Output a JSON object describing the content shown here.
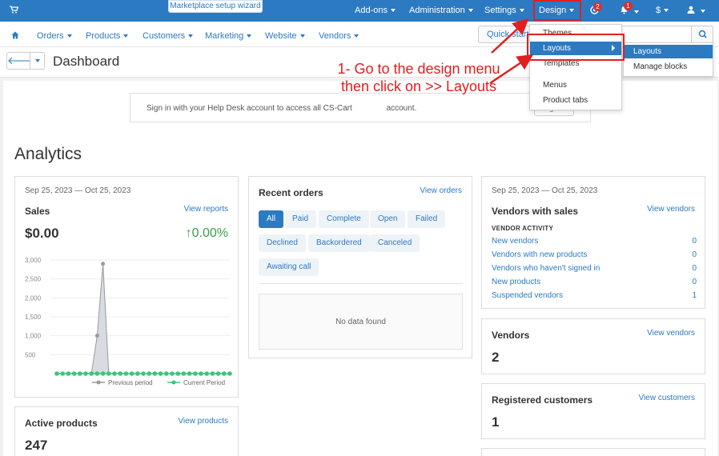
{
  "topbar": {
    "setup_button": "Marketplace setup wizard",
    "items": [
      "Add-ons",
      "Administration",
      "Settings",
      "Design"
    ],
    "cart_badge": "2",
    "bell_badge": "1",
    "currency": "$"
  },
  "subnav": {
    "items": [
      "Orders",
      "Products",
      "Customers",
      "Marketing",
      "Website",
      "Vendors"
    ],
    "quick_start": "Quick start"
  },
  "header": {
    "title": "Dashboard"
  },
  "design_menu": {
    "items": [
      "Themes",
      "Layouts",
      "Templates",
      "Menus",
      "Product tabs"
    ],
    "submenu": [
      "Layouts",
      "Manage blocks"
    ]
  },
  "annotation": "1- Go to the design menu then click on >> Layouts",
  "helpdesk": {
    "text": "Sign in with your Help Desk account to access all CS-Cart",
    "text_tail": "account.",
    "button": "Sign in"
  },
  "analytics_title": "Analytics",
  "sales": {
    "date_range": "Sep 25, 2023 — Oct 25, 2023",
    "title": "Sales",
    "link": "View reports",
    "amount": "$0.00",
    "change": "0.00%",
    "change_arrow": "↑",
    "legend_previous": "Previous period",
    "legend_current": "Current Period"
  },
  "recent_orders": {
    "title": "Recent orders",
    "link": "View orders",
    "filters": [
      "All",
      "Paid",
      "Complete",
      "Open",
      "Failed",
      "Declined",
      "Backordered",
      "Canceled",
      "Awaiting call"
    ],
    "empty": "No data found"
  },
  "vendors_sales": {
    "date_range": "Sep 25, 2023 — Oct 25, 2023",
    "title": "Vendors with sales",
    "link": "View vendors",
    "section_label": "VENDOR ACTIVITY",
    "rows": [
      {
        "label": "New vendors",
        "count": "0"
      },
      {
        "label": "Vendors with new products",
        "count": "0"
      },
      {
        "label": "Vendors who haven't signed in",
        "count": "0"
      },
      {
        "label": "New products",
        "count": "0"
      },
      {
        "label": "Suspended vendors",
        "count": "1"
      }
    ]
  },
  "vendors": {
    "title": "Vendors",
    "link": "View vendors",
    "value": "2"
  },
  "registered_customers": {
    "title": "Registered customers",
    "link": "View customers",
    "value": "1"
  },
  "active_products": {
    "title": "Active products",
    "link": "View products",
    "value": "247"
  },
  "chart_data": {
    "type": "area",
    "yticks": [
      "3,000",
      "2,500",
      "2,000",
      "1,500",
      "1,000",
      "500"
    ],
    "ylim": [
      0,
      3000
    ],
    "series": [
      {
        "name": "Previous period",
        "values": [
          0,
          0,
          0,
          0,
          0,
          0,
          0,
          1000,
          2900,
          0,
          0,
          0,
          0,
          0,
          0,
          0,
          0,
          0,
          0,
          0,
          0,
          0,
          0,
          0,
          0,
          0,
          0,
          0,
          0,
          0,
          0
        ],
        "color": "#999999"
      },
      {
        "name": "Current Period",
        "values": [
          0,
          0,
          0,
          0,
          0,
          0,
          0,
          0,
          0,
          0,
          0,
          0,
          0,
          0,
          0,
          0,
          0,
          0,
          0,
          0,
          0,
          0,
          0,
          0,
          0,
          0,
          0,
          0,
          0,
          0,
          0
        ],
        "color": "#3cc47c"
      }
    ],
    "grid": true
  },
  "colors": {
    "primary": "#2b7ac2",
    "annotation": "#e02020",
    "positive": "#3aa04a"
  }
}
